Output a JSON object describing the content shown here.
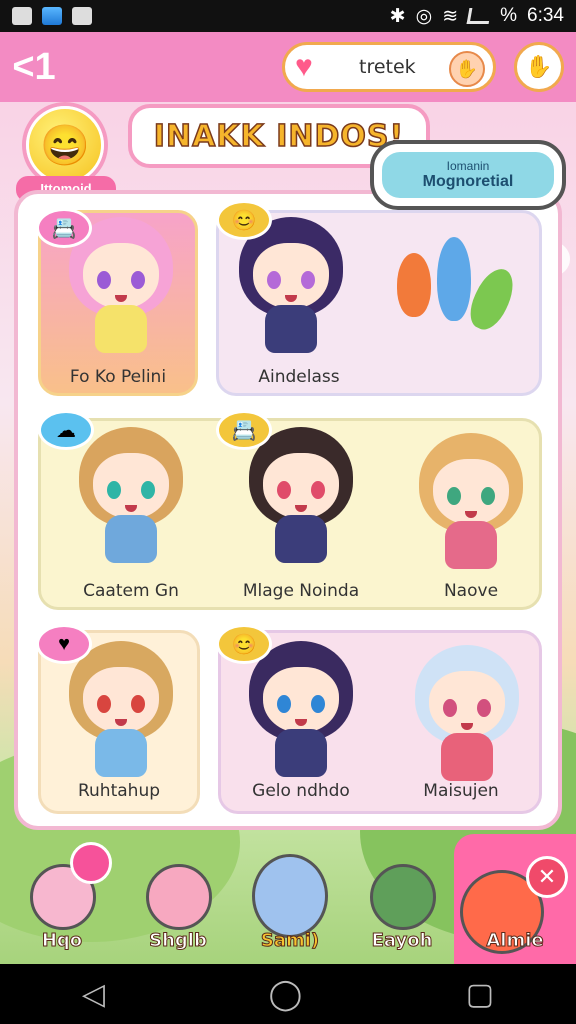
{
  "status_bar": {
    "time": "6:34",
    "battery_text": "%"
  },
  "top_bar": {
    "back_glyph": "<1",
    "search_value": "tretek",
    "heart_glyph": "♥",
    "pill_icon": "search-hand-icon",
    "profile_icon": "settings-hand-icon"
  },
  "header": {
    "title": "INAKK INDOS!",
    "badge_label": "Ittomoid",
    "speech_small": "Iomanin",
    "speech_big": "Mognoretial"
  },
  "characters": [
    {
      "name": "Fo Ko Pelini",
      "hair": "#f6a3d6",
      "eyes": "#9b5bd6",
      "outfit": "#f5e26a",
      "card_bg": "#f9b98a",
      "tag_color": "#f57fc1",
      "tag_icon": "📇"
    },
    {
      "name": "Aindelass",
      "hair": "#3b2a66",
      "eyes": "#b46ad8",
      "outfit": "#3b3d7a",
      "card_bg": "#f6e6f2",
      "tag_color": "#f3c63b",
      "tag_icon": "😊"
    },
    {
      "name": "Caatem Gn",
      "hair": "#d9a45e",
      "eyes": "#2fb5a6",
      "outfit": "#6fa8dc",
      "card_bg": "#fbf5cf",
      "tag_color": "#5bc1ef",
      "tag_icon": "☁"
    },
    {
      "name": "Mlage Noinda",
      "hair": "#3a2a2a",
      "eyes": "#e04c6a",
      "outfit": "#3b3d7a",
      "card_bg": "#fbf5cf",
      "tag_color": "#f3c63b",
      "tag_icon": "📇"
    },
    {
      "name": "Naove",
      "hair": "#e7b36a",
      "eyes": "#3fa77f",
      "outfit": "#e56a8a",
      "card_bg": "#fbf5cf",
      "tag_color": "",
      "tag_icon": ""
    },
    {
      "name": "Ruhtahup",
      "hair": "#d8a860",
      "eyes": "#d8453f",
      "outfit": "#7ab9e8",
      "card_bg": "#fff1d8",
      "tag_color": "#f57fc1",
      "tag_icon": "♥"
    },
    {
      "name": "Gelo ndhdo",
      "hair": "#3a2a60",
      "eyes": "#2f86d6",
      "outfit": "#3b3d7a",
      "card_bg": "#f9e0ec",
      "tag_color": "#f3c63b",
      "tag_icon": "😊"
    },
    {
      "name": "Maisujen",
      "hair": "#cfe2f6",
      "eyes": "#d2507e",
      "outfit": "#e8627a",
      "card_bg": "#f9e0ec",
      "tag_color": "",
      "tag_icon": ""
    }
  ],
  "bottom_nav": [
    {
      "label": "Hqo",
      "color": "#f7b7cf"
    },
    {
      "label": "Shglb",
      "color": "#f7a8c0"
    },
    {
      "label": "Sami)",
      "color": "#9fc2ee"
    },
    {
      "label": "Eayoh",
      "color": "#5f9f5a"
    },
    {
      "label": "Almie",
      "color": "#ff6a4a"
    }
  ],
  "android_nav": {
    "back": "◁",
    "home": "◯",
    "recents": "▢"
  }
}
